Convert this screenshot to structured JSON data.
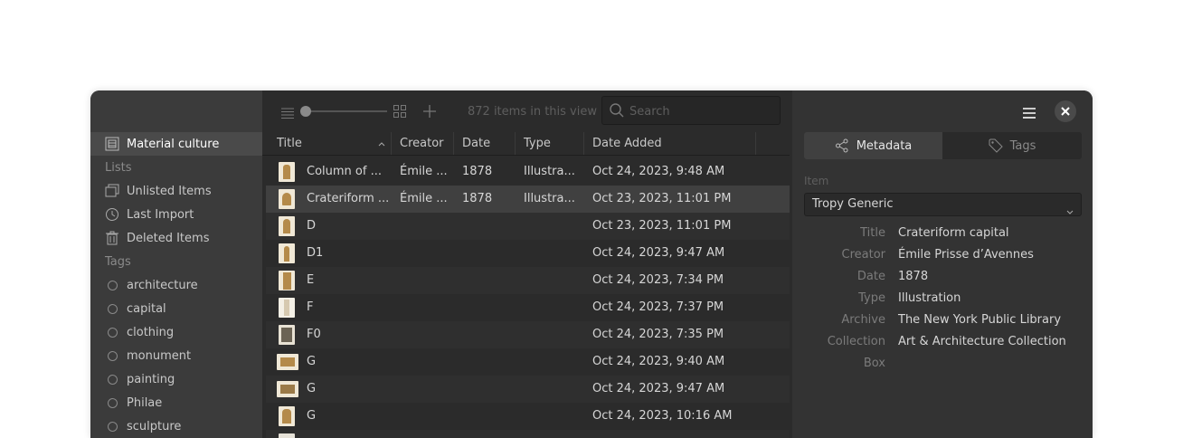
{
  "sidebar": {
    "selected_project": "Material culture",
    "lists_heading": "Lists",
    "lists": [
      {
        "label": "Unlisted Items",
        "icon": "unlisted-items-icon"
      },
      {
        "label": "Last Import",
        "icon": "clock-icon"
      },
      {
        "label": "Deleted Items",
        "icon": "trash-icon"
      }
    ],
    "tags_heading": "Tags",
    "tags": [
      "architecture",
      "capital",
      "clothing",
      "monument",
      "painting",
      "Philae",
      "sculpture"
    ]
  },
  "toolbar": {
    "item_count": "872 items in this view",
    "search_placeholder": "Search",
    "zoom_level": 0
  },
  "table": {
    "columns": [
      "Title",
      "Creator",
      "Date",
      "Type",
      "Date Added"
    ],
    "rows": [
      {
        "title": "Column of ...",
        "creator": "Émile ...",
        "date": "1878",
        "type": "Illustra...",
        "added": "Oct 24, 2023, 9:48 AM"
      },
      {
        "title": "Crateriform ...",
        "creator": "Émile ...",
        "date": "1878",
        "type": "Illustra...",
        "added": "Oct 23, 2023, 11:01 PM"
      },
      {
        "title": "D",
        "creator": "",
        "date": "",
        "type": "",
        "added": "Oct 23, 2023, 11:01 PM"
      },
      {
        "title": "D1",
        "creator": "",
        "date": "",
        "type": "",
        "added": "Oct 24, 2023, 9:47 AM"
      },
      {
        "title": "E",
        "creator": "",
        "date": "",
        "type": "",
        "added": "Oct 24, 2023, 7:34 PM"
      },
      {
        "title": "F",
        "creator": "",
        "date": "",
        "type": "",
        "added": "Oct 24, 2023, 7:37 PM"
      },
      {
        "title": "F0",
        "creator": "",
        "date": "",
        "type": "",
        "added": "Oct 24, 2023, 7:35 PM"
      },
      {
        "title": "G",
        "creator": "",
        "date": "",
        "type": "",
        "added": "Oct 24, 2023, 9:40 AM"
      },
      {
        "title": "G",
        "creator": "",
        "date": "",
        "type": "",
        "added": "Oct 24, 2023, 9:47 AM"
      },
      {
        "title": "G",
        "creator": "",
        "date": "",
        "type": "",
        "added": "Oct 24, 2023, 10:16 AM"
      }
    ]
  },
  "panel": {
    "tabs": [
      "Metadata",
      "Tags"
    ],
    "item_label": "Item",
    "template": "Tropy Generic",
    "fields": [
      {
        "label": "Title",
        "value": "Crateriform capital"
      },
      {
        "label": "Creator",
        "value": "Émile Prisse d’Avennes"
      },
      {
        "label": "Date",
        "value": "1878"
      },
      {
        "label": "Type",
        "value": "Illustration"
      },
      {
        "label": "Archive",
        "value": "The New York Public Library"
      },
      {
        "label": "Collection",
        "value": "Art & Architecture Collection"
      },
      {
        "label": "Box",
        "value": ""
      }
    ]
  }
}
